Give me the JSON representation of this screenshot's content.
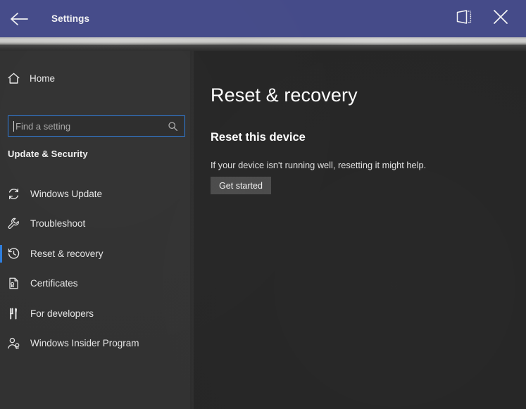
{
  "titlebar": {
    "title": "Settings",
    "back_icon": "back-arrow-icon",
    "project_icon": "project-display-icon",
    "close_icon": "close-icon",
    "background_color": "#454b89"
  },
  "sidebar": {
    "home": {
      "label": "Home",
      "icon": "home-icon"
    },
    "search": {
      "value": "",
      "placeholder": "Find a setting",
      "icon": "search-icon"
    },
    "group_header": "Update & Security",
    "accent_color": "#2e7ddd",
    "items": [
      {
        "label": "Windows Update",
        "icon": "sync-refresh-icon",
        "selected": false
      },
      {
        "label": "Troubleshoot",
        "icon": "wrench-icon",
        "selected": false
      },
      {
        "label": "Reset & recovery",
        "icon": "clock-history-icon",
        "selected": true
      },
      {
        "label": "Certificates",
        "icon": "certificate-document-icon",
        "selected": false
      },
      {
        "label": "For developers",
        "icon": "developer-tools-icon",
        "selected": false
      },
      {
        "label": "Windows Insider Program",
        "icon": "person-badge-icon",
        "selected": false
      }
    ]
  },
  "main": {
    "page_title": "Reset & recovery",
    "section_title": "Reset this device",
    "section_description": "If your device isn't running well, resetting it might help.",
    "get_started_label": "Get started"
  }
}
